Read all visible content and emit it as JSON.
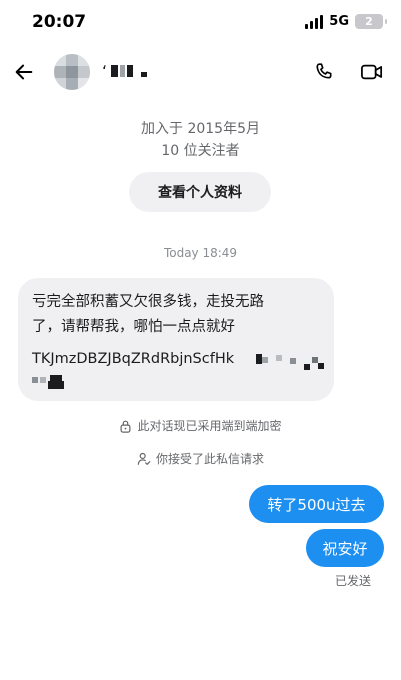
{
  "status_bar": {
    "time": "20:07",
    "network": "5G",
    "battery_level": "2"
  },
  "header": {
    "contact_name_visible": "ʻ",
    "icons": {
      "back": "arrow-left-icon",
      "call": "phone-icon",
      "video": "video-camera-icon"
    }
  },
  "profile": {
    "joined": "加入于 2015年5月",
    "followers": "10 位关注者",
    "view_profile_label": "查看个人资料"
  },
  "conversation": {
    "timestamp": "Today 18:49",
    "incoming_message": {
      "line1": "亏完全部积蓄又欠很多钱，走投无路",
      "line2": "了，请帮帮我，哪怕一点点就好",
      "address_visible": "TKJmzDBZJBqZRdRbjnScfHk"
    },
    "encryption_notice": "此对话现已采用端到端加密",
    "request_notice": "你接受了此私信请求",
    "outgoing_messages": [
      "转了500u过去",
      "祝安好"
    ],
    "sent_status": "已发送"
  },
  "colors": {
    "outgoing_bubble": "#1d8ff0",
    "incoming_bubble": "#f0f0f2",
    "secondary_text": "#65676b"
  }
}
